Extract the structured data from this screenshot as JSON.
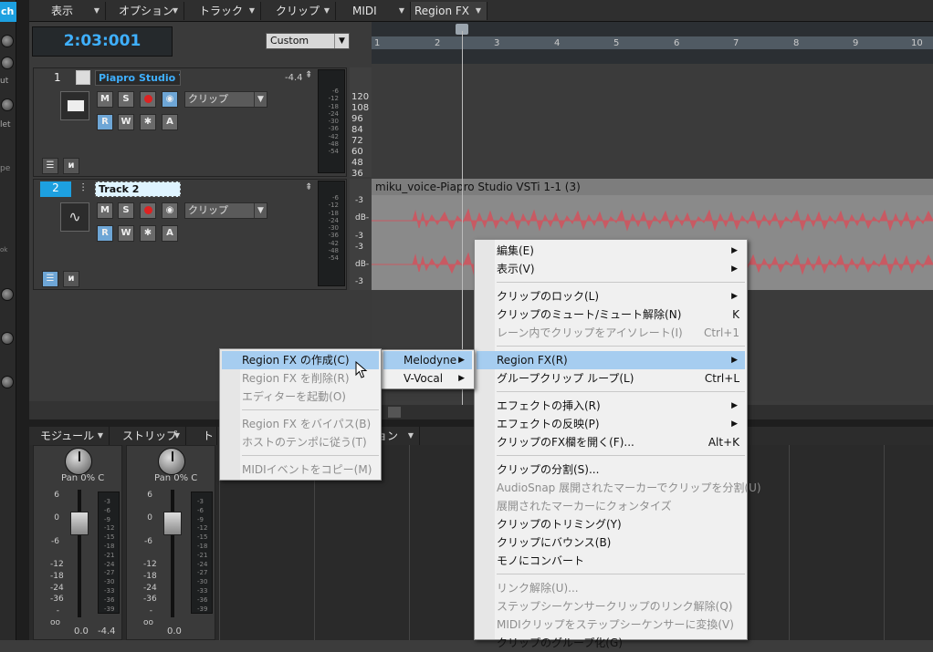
{
  "left_strip": {
    "ch_label": "ch",
    "labels": [
      "ut",
      "let",
      "pe",
      "ok"
    ]
  },
  "menubar": {
    "items": [
      "表示",
      "オプション",
      "トラック",
      "クリップ",
      "MIDI",
      "Region FX"
    ]
  },
  "transport": {
    "time": "2:03:001",
    "preset": "Custom"
  },
  "ruler": {
    "ticks": [
      "1",
      "2",
      "3",
      "4",
      "5",
      "6",
      "7",
      "8",
      "9",
      "10"
    ]
  },
  "track1": {
    "number": "1",
    "name": "Piapro Studio V",
    "level": "-4.4",
    "mute": "M",
    "solo": "S",
    "read": "R",
    "write": "W",
    "archive": "A",
    "input": "クリップ",
    "piano_scale": [
      "120",
      "108",
      "96",
      "84",
      "72",
      "60",
      "48",
      "36"
    ],
    "meter_scale": [
      "-6",
      "-12",
      "-18",
      "-24",
      "-30",
      "-36",
      "-42",
      "-48",
      "-54"
    ]
  },
  "track2": {
    "number": "2",
    "name": "Track 2",
    "mute": "M",
    "solo": "S",
    "read": "R",
    "write": "W",
    "archive": "A",
    "input": "クリップ",
    "meter_scale": [
      "-6",
      "-12",
      "-18",
      "-24",
      "-30",
      "-36",
      "-42",
      "-48",
      "-54"
    ],
    "db_scale": [
      "-3",
      "dB-",
      "-3",
      "-3",
      "dB-",
      "-3"
    ]
  },
  "clip": {
    "title": "miku_voice-Piapro Studio VSTi 1-1 (3)"
  },
  "mixer": {
    "header": [
      "モジュール",
      "ストリップ",
      "トラ",
      "ョン"
    ],
    "strip1": {
      "pan": "Pan 0% C",
      "value": "0.0",
      "peak": "-4.4"
    },
    "strip2": {
      "pan": "Pan 0% C",
      "value": "0.0"
    },
    "fader_scale": [
      "6",
      "0",
      "-6",
      "-12",
      "-18",
      "-24",
      "-36",
      "-oo"
    ],
    "meter_scale": [
      "-3",
      "-6",
      "-9",
      "-12",
      "-15",
      "-18",
      "-21",
      "-24",
      "-27",
      "-30",
      "-33",
      "-36",
      "-39"
    ]
  },
  "menu_main": {
    "items": [
      {
        "label": "編集(E)",
        "sub": true
      },
      {
        "label": "表示(V)",
        "sub": true
      },
      {
        "label": "クリップのロック(L)",
        "sub": true
      },
      {
        "label": "クリップのミュート/ミュート解除(N)",
        "shortcut": "K"
      },
      {
        "label": "レーン内でクリップをアイソレート(I)",
        "shortcut": "Ctrl+1",
        "disabled": true
      },
      {
        "label": "Region FX(R)",
        "sub": true,
        "highlight": true
      },
      {
        "label": "グループクリップ ループ(L)",
        "shortcut": "Ctrl+L"
      },
      {
        "label": "エフェクトの挿入(R)",
        "sub": true
      },
      {
        "label": "エフェクトの反映(P)",
        "sub": true
      },
      {
        "label": "クリップのFX欄を開く(F)...",
        "shortcut": "Alt+K"
      },
      {
        "label": "クリップの分割(S)..."
      },
      {
        "label": "AudioSnap 展開されたマーカーでクリップを分割(U)",
        "disabled": true
      },
      {
        "label": "展開されたマーカーにクォンタイズ",
        "disabled": true
      },
      {
        "label": "クリップのトリミング(Y)"
      },
      {
        "label": "クリップにバウンス(B)"
      },
      {
        "label": "モノにコンバート"
      },
      {
        "label": "リンク解除(U)...",
        "disabled": true
      },
      {
        "label": "ステップシーケンサークリップのリンク解除(Q)",
        "disabled": true
      },
      {
        "label": "MIDIクリップをステップシーケンサーに変換(V)",
        "disabled": true
      },
      {
        "label": "クリップのグループ化(G)"
      }
    ]
  },
  "menu_regionfx": {
    "items": [
      {
        "label": "Melodyne",
        "sub": true,
        "highlight": true
      },
      {
        "label": "V-Vocal",
        "sub": true
      }
    ]
  },
  "menu_melodyne": {
    "items": [
      {
        "label": "Region FX の作成(C)",
        "highlight": true
      },
      {
        "label": "Region FX を削除(R)",
        "disabled": true
      },
      {
        "label": "エディターを起動(O)",
        "disabled": true
      },
      {
        "label": "Region FX をバイパス(B)",
        "disabled": true
      },
      {
        "label": "ホストのテンポに従う(T)",
        "disabled": true
      },
      {
        "label": "MIDIイベントをコピー(M)",
        "disabled": true
      }
    ]
  },
  "colors": {
    "accent": "#3fb0ff",
    "wave": "#c85a63",
    "highlight": "#a6cdf0"
  }
}
